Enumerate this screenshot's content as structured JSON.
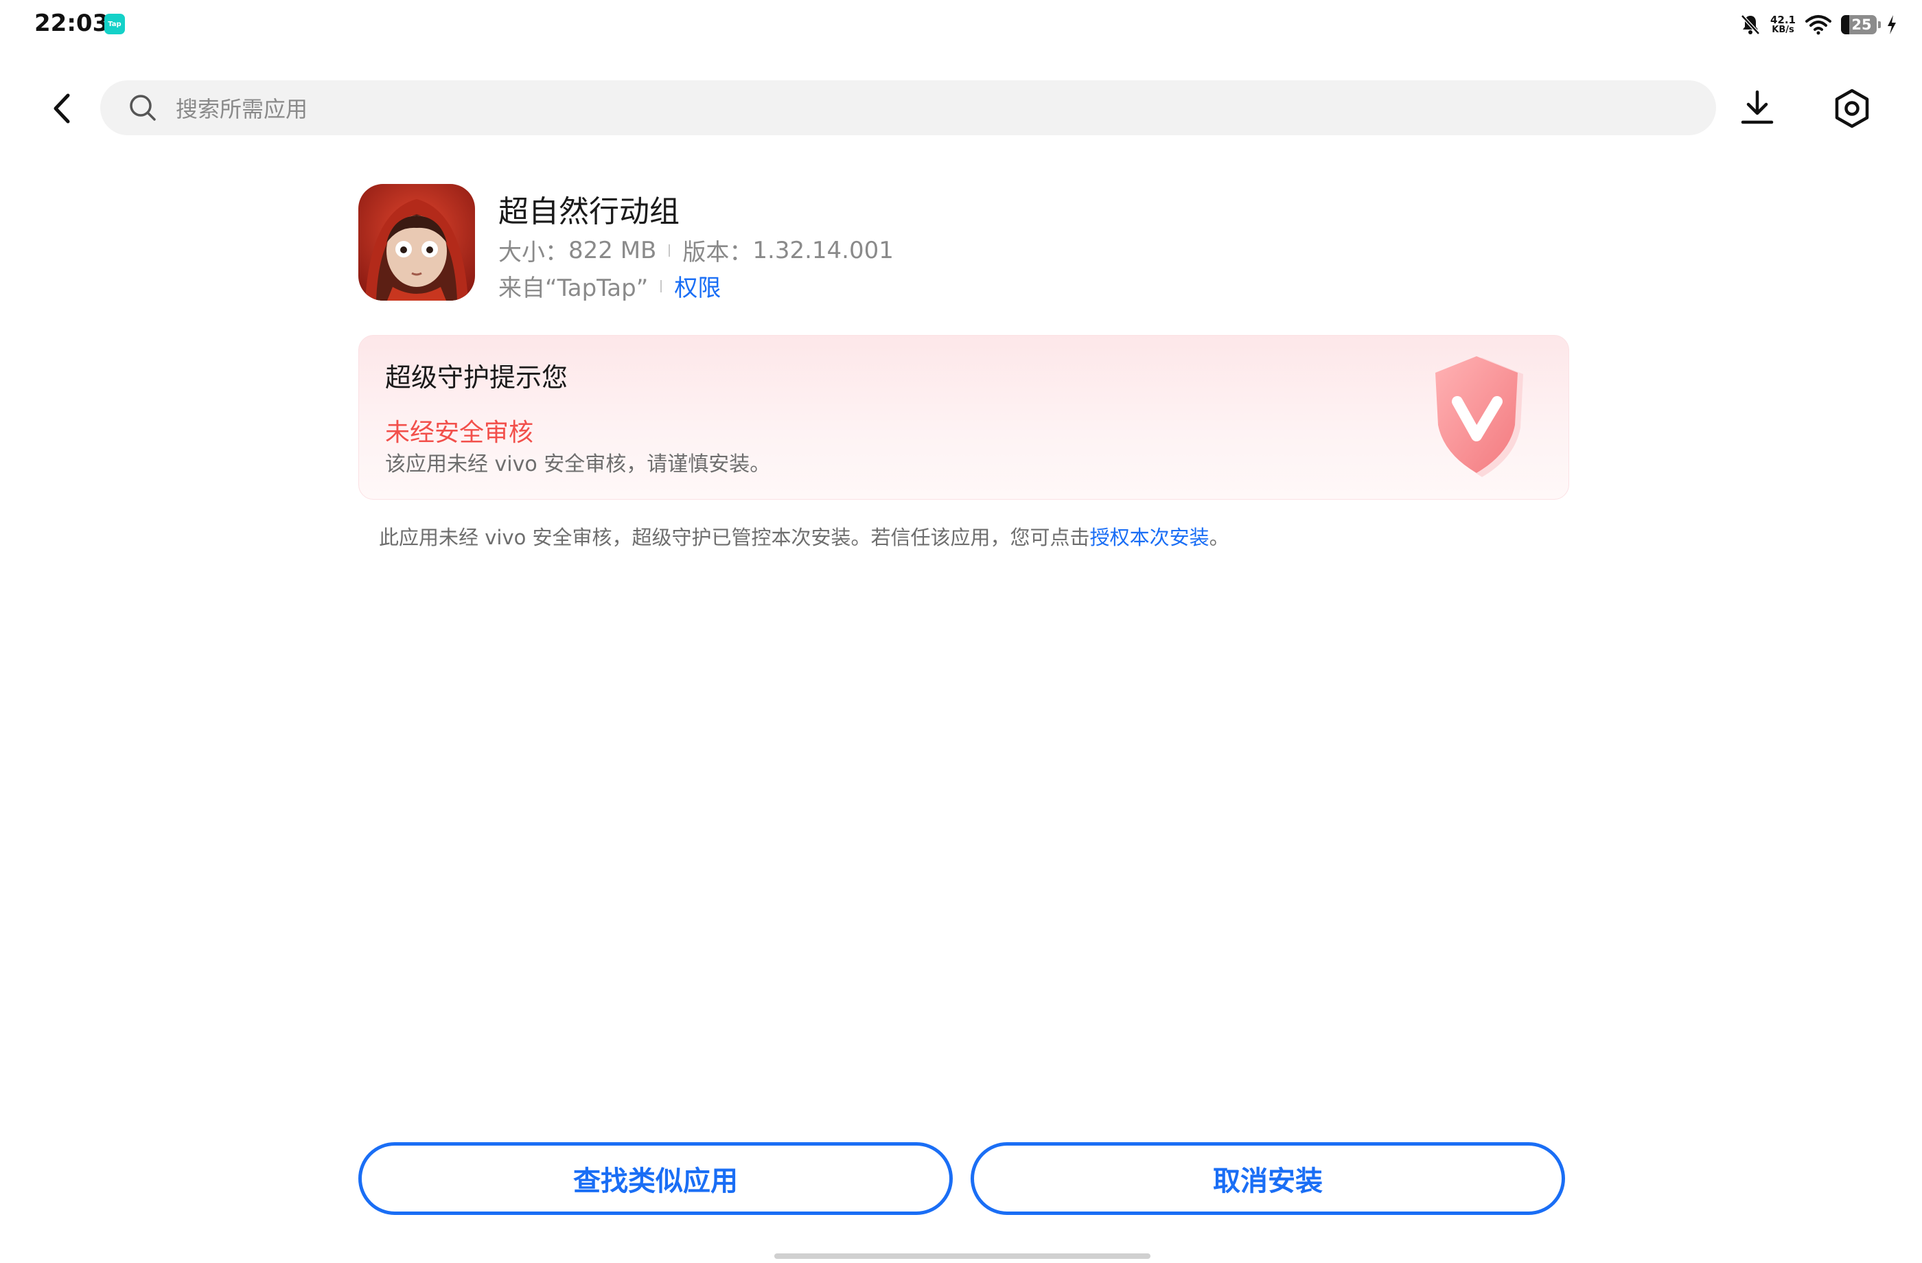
{
  "status_bar": {
    "time": "22:03",
    "tap_badge": "Tap",
    "net_speed_value": "42.1",
    "net_speed_unit": "KB/s",
    "battery_level": "25"
  },
  "search": {
    "placeholder": "搜索所需应用"
  },
  "app": {
    "name": "超自然行动组",
    "size_label": "大小：",
    "size_value": "822 MB",
    "version_label": "版本：",
    "version_value": "1.32.14.001",
    "source": "来自“TapTap”",
    "permissions_link": "权限"
  },
  "warning": {
    "title": "超级守护提示您",
    "subtitle": "未经安全审核",
    "description": "该应用未经 vivo 安全审核，请谨慎安装。"
  },
  "notice": {
    "text": "此应用未经 vivo 安全审核，超级守护已管控本次安装。若信任该应用，您可点击",
    "link": "授权本次安装",
    "suffix": "。"
  },
  "buttons": {
    "find_similar": "查找类似应用",
    "cancel_install": "取消安装"
  },
  "colors": {
    "accent": "#1a6ef5",
    "warning_red": "#f2504b",
    "card_bg": "#fde7e9"
  }
}
